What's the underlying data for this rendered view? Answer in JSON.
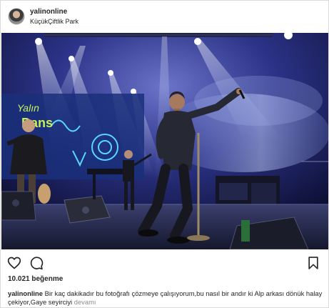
{
  "post": {
    "username": "yalinonline",
    "location": "KüçükÇiftlik Park",
    "likes": "10.021 beğenme",
    "caption_user": "yalinonline",
    "caption_text": " Bir kaç dakikadır bu fotoğrafı çözmeye çalışıyorum,bu nasıl bir andır ki Alp arkası dönük halay çekiyor,Gaye seyirciyi ",
    "caption_more": "devamı"
  },
  "photo_texts": {
    "banner_line1": "Yalın",
    "banner_line2": "Dans"
  },
  "icons": {
    "avatar": "profile-avatar",
    "like": "heart-outline-icon",
    "comment": "comment-bubble-icon",
    "save": "bookmark-outline-icon"
  },
  "colors": {
    "stage_blue": "#1c1f55",
    "stage_light": "#cfe3ff",
    "text": "#262626",
    "muted": "#8e8e8e"
  }
}
